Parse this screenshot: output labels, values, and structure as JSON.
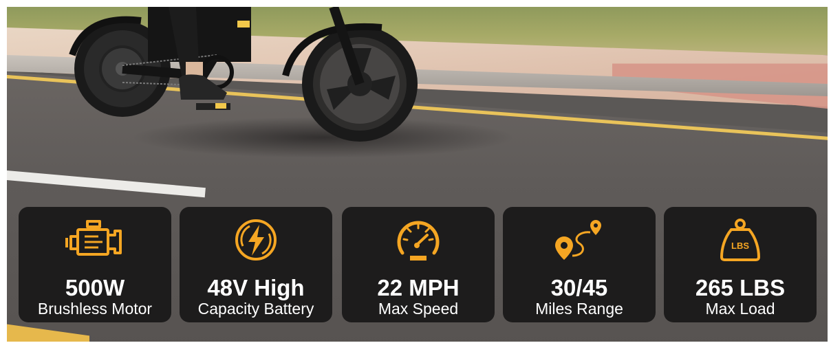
{
  "accent_color": "#f5a623",
  "card_color": "#1d1c1c",
  "features": [
    {
      "icon": "engine-icon",
      "value": "500W",
      "label": "Brushless Motor"
    },
    {
      "icon": "lightning-bolt-icon",
      "value": "48V High",
      "label": "Capacity Battery"
    },
    {
      "icon": "speedometer-icon",
      "value": "22 MPH",
      "label": "Max Speed"
    },
    {
      "icon": "route-pin-icon",
      "value": "30/45",
      "label": "Miles Range"
    },
    {
      "icon": "weight-icon",
      "value": "265 LBS",
      "label": "Max Load",
      "icon_text": "LBS"
    }
  ]
}
